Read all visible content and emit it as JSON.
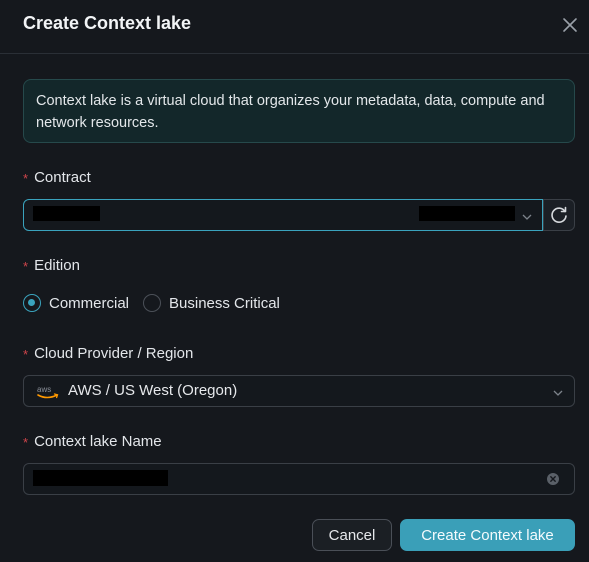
{
  "dialog": {
    "title": "Create Context lake"
  },
  "info_banner": {
    "text": "Context lake is a virtual cloud that organizes your metadata, data, compute and network resources."
  },
  "required_marker": "*",
  "contract": {
    "label": "Contract"
  },
  "edition": {
    "label": "Edition",
    "options": [
      {
        "label": "Commercial",
        "selected": true
      },
      {
        "label": "Business Critical",
        "selected": false
      }
    ]
  },
  "cloud_region": {
    "label": "Cloud Provider / Region",
    "value": "AWS / US West (Oregon)",
    "provider_logo": "aws"
  },
  "lake_name": {
    "label": "Context lake Name"
  },
  "footer": {
    "cancel_label": "Cancel",
    "create_label": "Create Context lake"
  },
  "colors": {
    "accent": "#3a9fb8",
    "required": "#d0454b",
    "background": "#15181d",
    "banner_bg": "#13272a"
  }
}
